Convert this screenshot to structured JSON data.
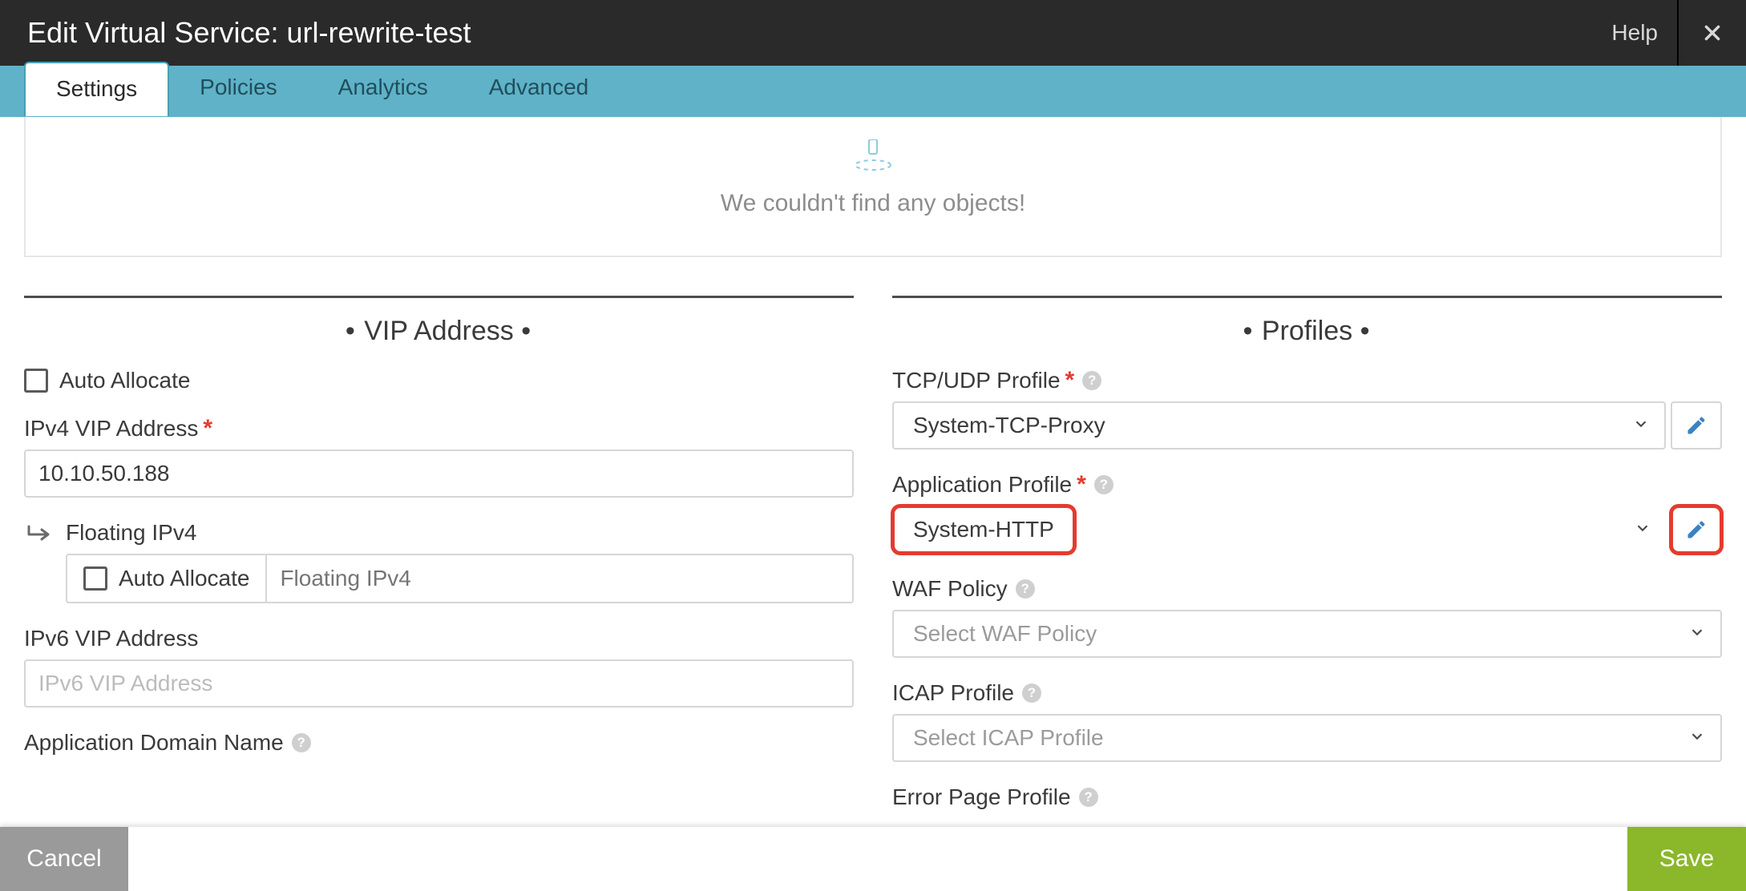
{
  "header": {
    "title": "Edit Virtual Service: url-rewrite-test",
    "help": "Help"
  },
  "tabs": [
    {
      "label": "Settings",
      "active": true
    },
    {
      "label": "Policies",
      "active": false
    },
    {
      "label": "Analytics",
      "active": false
    },
    {
      "label": "Advanced",
      "active": false
    }
  ],
  "empty_msg": "We couldn't find any objects!",
  "left": {
    "section": "VIP Address",
    "auto_allocate": "Auto Allocate",
    "ipv4_label": "IPv4 VIP Address",
    "ipv4_value": "10.10.50.188",
    "float_label": "Floating IPv4",
    "float_auto": "Auto Allocate",
    "float_placeholder": "Floating IPv4",
    "ipv6_label": "IPv6 VIP Address",
    "ipv6_placeholder": "IPv6 VIP Address",
    "app_domain_label": "Application Domain Name"
  },
  "right": {
    "section": "Profiles",
    "tcp_label": "TCP/UDP Profile",
    "tcp_value": "System-TCP-Proxy",
    "app_label": "Application Profile",
    "app_value": "System-HTTP",
    "waf_label": "WAF Policy",
    "waf_placeholder": "Select WAF Policy",
    "icap_label": "ICAP Profile",
    "icap_placeholder": "Select ICAP Profile",
    "err_label": "Error Page Profile"
  },
  "footer": {
    "cancel": "Cancel",
    "save": "Save"
  },
  "colors": {
    "tabbar": "#5fb2c7",
    "save": "#8bb72a",
    "highlight": "#e43b2f",
    "pencil": "#3b82c4"
  }
}
